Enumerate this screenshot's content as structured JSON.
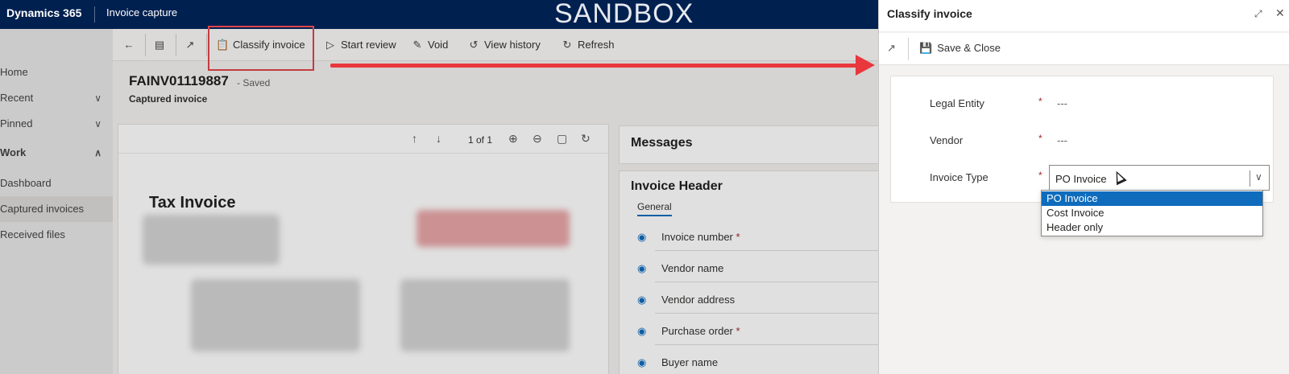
{
  "topbar": {
    "brand": "Dynamics 365",
    "app": "Invoice capture",
    "environment": "SANDBOX"
  },
  "nav": {
    "items": [
      {
        "label": "Home"
      },
      {
        "label": "Recent",
        "chevron": "chevron-down"
      },
      {
        "label": "Pinned",
        "chevron": "chevron-down"
      },
      {
        "label": "Work",
        "chevron": "chevron-up"
      },
      {
        "label": "Dashboard"
      },
      {
        "label": "Captured invoices",
        "active": true
      },
      {
        "label": "Received files"
      }
    ]
  },
  "commands": {
    "classify": "Classify invoice",
    "start_review": "Start review",
    "void": "Void",
    "view_history": "View history",
    "refresh": "Refresh"
  },
  "record": {
    "title": "FAINV01119887",
    "status": "- Saved",
    "subtitle": "Captured invoice"
  },
  "doc_viewer": {
    "page_indicator": "1 of 1",
    "doc_title": "Tax Invoice"
  },
  "messages": {
    "title": "Messages"
  },
  "invoice_header": {
    "title": "Invoice Header",
    "tab": "General",
    "fields": [
      {
        "label": "Invoice number",
        "required": "*"
      },
      {
        "label": "Vendor name",
        "required": ""
      },
      {
        "label": "Vendor address",
        "required": ""
      },
      {
        "label": "Purchase order",
        "required": "*"
      },
      {
        "label": "Buyer name",
        "required": ""
      }
    ]
  },
  "dialog": {
    "title": "Classify invoice",
    "save_close": "Save & Close",
    "fields": {
      "legal_entity": {
        "label": "Legal Entity",
        "required": "*",
        "value": "---"
      },
      "vendor": {
        "label": "Vendor",
        "required": "*",
        "value": "---"
      },
      "invoice_type": {
        "label": "Invoice Type",
        "required": "*",
        "value": "PO Invoice"
      }
    },
    "options": [
      "PO Invoice",
      "Cost Invoice",
      "Header only"
    ],
    "selected_option": "PO Invoice"
  },
  "colors": {
    "topbar": "#002050",
    "accent": "#0f6cbd",
    "highlight": "#e0454a",
    "required": "#a4262c"
  }
}
